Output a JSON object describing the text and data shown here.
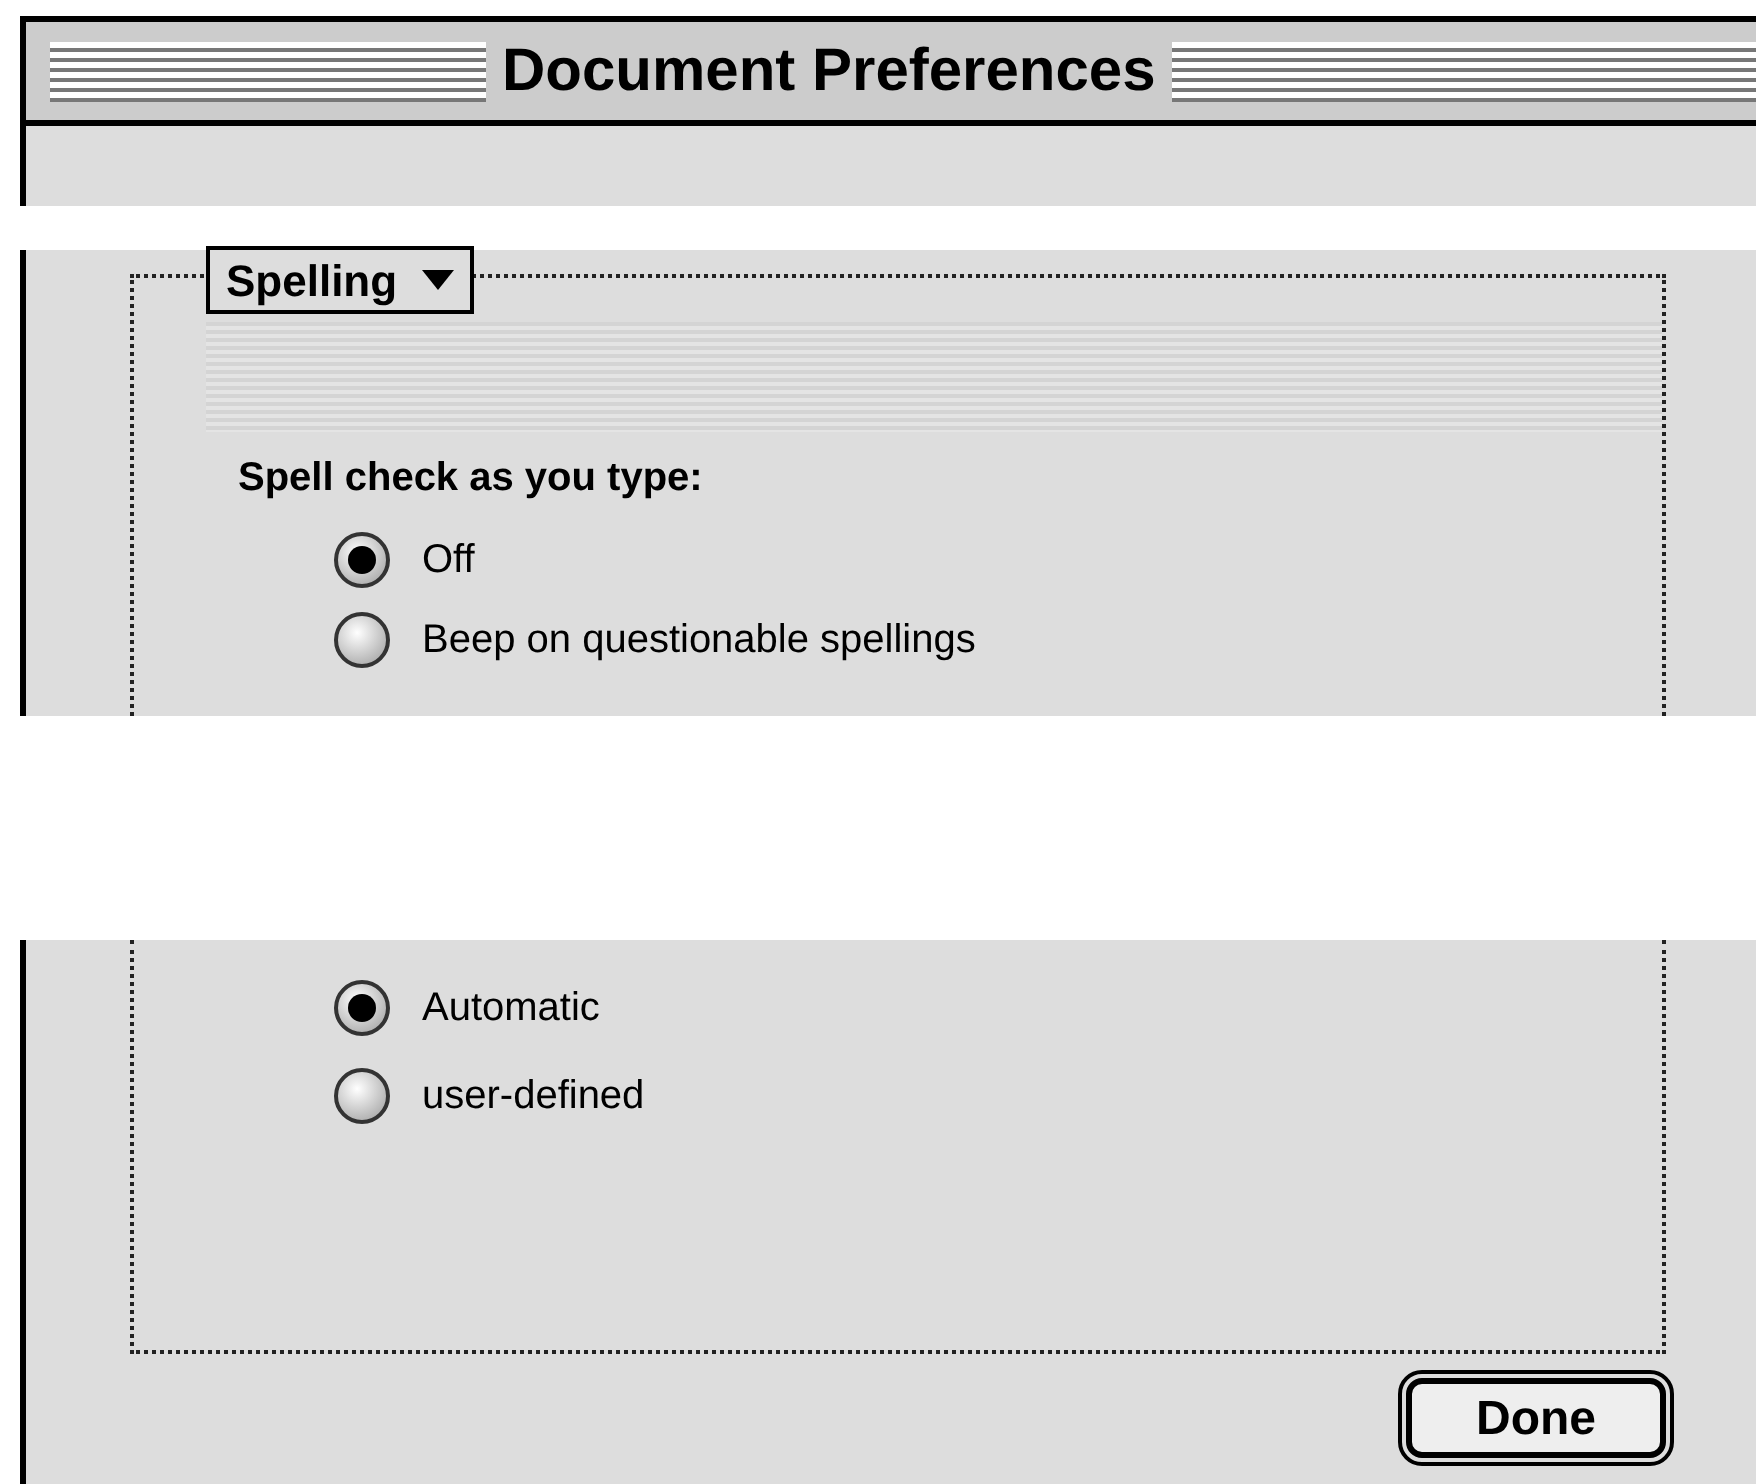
{
  "window": {
    "title": "Document Preferences"
  },
  "popup": {
    "label": "Spelling"
  },
  "spell_check": {
    "label": "Spell check as you type:",
    "options": [
      {
        "label": "Off",
        "selected": true
      },
      {
        "label": "Beep on questionable spellings",
        "selected": false
      }
    ]
  },
  "mode": {
    "options": [
      {
        "label": "Automatic",
        "selected": true
      },
      {
        "label": "user-defined",
        "selected": false
      }
    ]
  },
  "buttons": [
    {
      "label": "Done"
    }
  ]
}
